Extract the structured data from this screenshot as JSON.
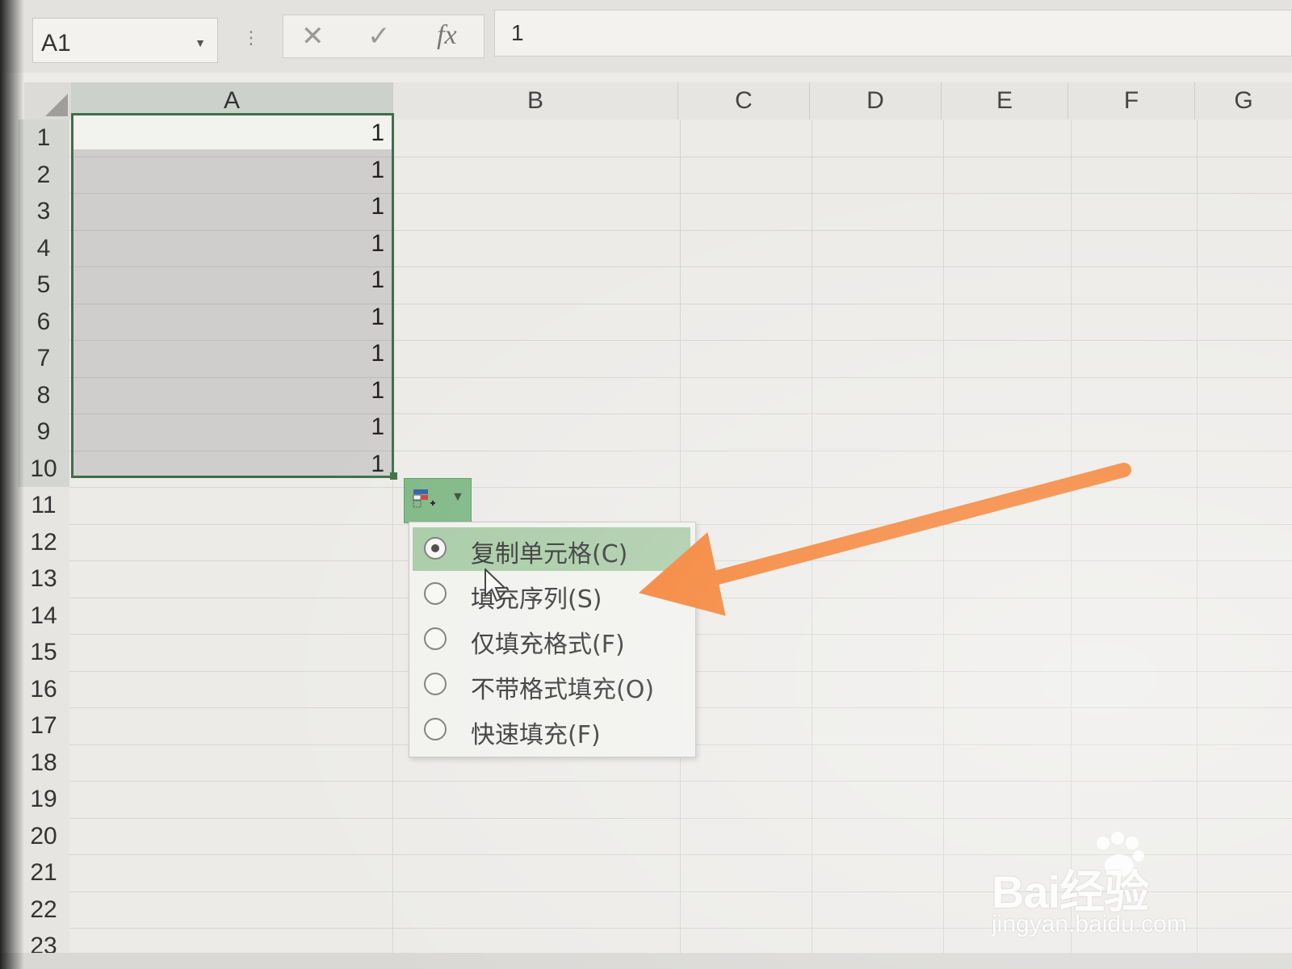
{
  "formula_bar": {
    "name_box": "A1",
    "cancel_symbol": "✕",
    "enter_symbol": "✓",
    "fx_label": "fx",
    "formula_value": "1"
  },
  "columns": [
    "A",
    "B",
    "C",
    "D",
    "E",
    "F",
    "G"
  ],
  "rows": [
    "1",
    "2",
    "3",
    "4",
    "5",
    "6",
    "7",
    "8",
    "9",
    "10",
    "11",
    "12",
    "13",
    "14",
    "15",
    "16",
    "17",
    "18",
    "19",
    "20",
    "21",
    "22",
    "23"
  ],
  "column_a_values": [
    "1",
    "1",
    "1",
    "1",
    "1",
    "1",
    "1",
    "1",
    "1",
    "1"
  ],
  "autofill_menu": {
    "options": [
      {
        "label": "复制单元格(C)",
        "selected": true
      },
      {
        "label": "填充序列(S)",
        "selected": false
      },
      {
        "label": "仅填充格式(F)",
        "selected": false
      },
      {
        "label": "不带格式填充(O)",
        "selected": false
      },
      {
        "label": "快速填充(F)",
        "selected": false
      }
    ]
  },
  "annotation": {
    "arrow_color": "#f47b2a"
  },
  "watermark": {
    "brand": "Bai经验",
    "url": "jingyan.baidu.com"
  }
}
